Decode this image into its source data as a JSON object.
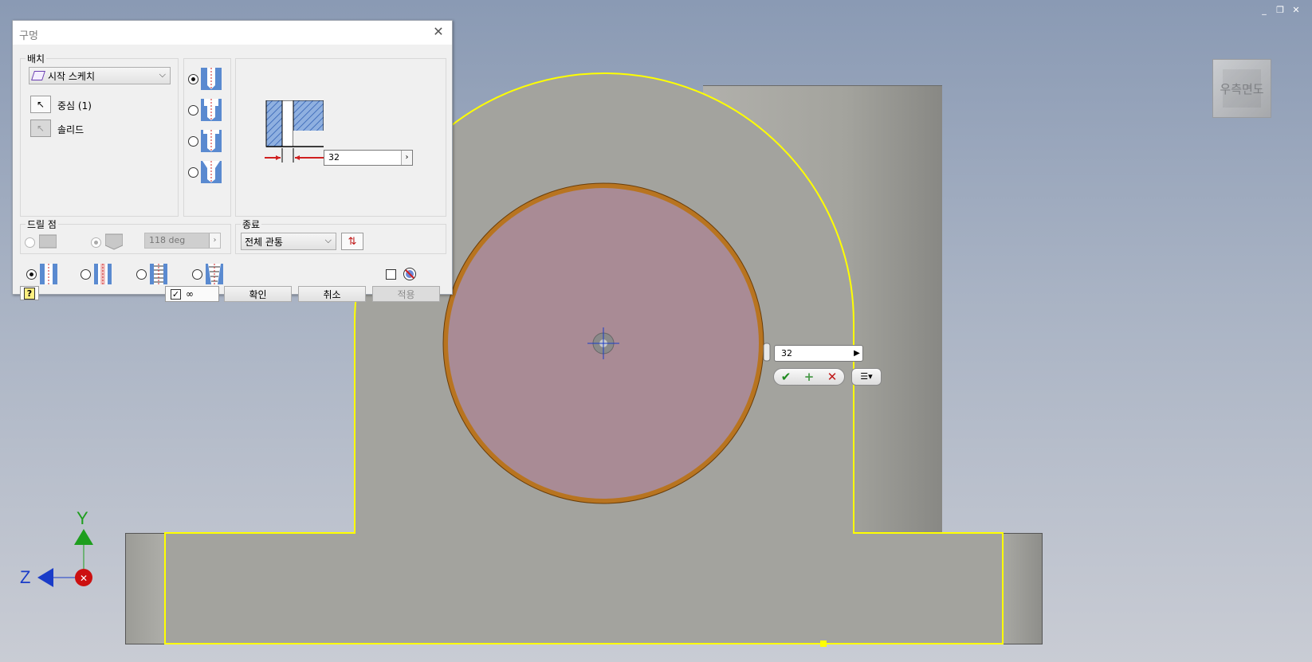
{
  "window_controls": {
    "minimize": "_",
    "restore": "❐",
    "close": "✕"
  },
  "viewcube": {
    "label": "우측면도"
  },
  "axes": {
    "y_label": "Y",
    "z_label": "Z"
  },
  "colors": {
    "edge_highlight": "#ffff00",
    "hole_face": "#aa8a96",
    "body": "#a5a5a0",
    "axis_y": "#1e9e1e",
    "axis_z": "#1a3cc8",
    "axis_x": "#cc1010"
  },
  "heads_up": {
    "diameter_value": "32",
    "apply_icon": "✔",
    "add_icon": "+",
    "cancel_icon": "✕",
    "menu_icon": "☰▾"
  },
  "dialog": {
    "title": "구멍",
    "placement": {
      "legend": "배치",
      "type_selected": "시작 스케치",
      "centers_label": "중심 (1)",
      "solid_label": "솔리드"
    },
    "hole_types": [
      "simple",
      "counterbore",
      "spotface",
      "countersink"
    ],
    "hole_type_selected": 0,
    "preview": {
      "diameter_value": "32"
    },
    "drill_point": {
      "legend": "드릴 점",
      "angle_value": "118 deg"
    },
    "termination": {
      "legend": "종료",
      "selected": "전체 관통"
    },
    "thread_types": [
      "simple-hole",
      "clearance",
      "tapped",
      "taper-tapped"
    ],
    "thread_type_selected": 0,
    "preview_checked": true,
    "buttons": {
      "ok": "확인",
      "cancel": "취소",
      "apply": "적용"
    }
  }
}
